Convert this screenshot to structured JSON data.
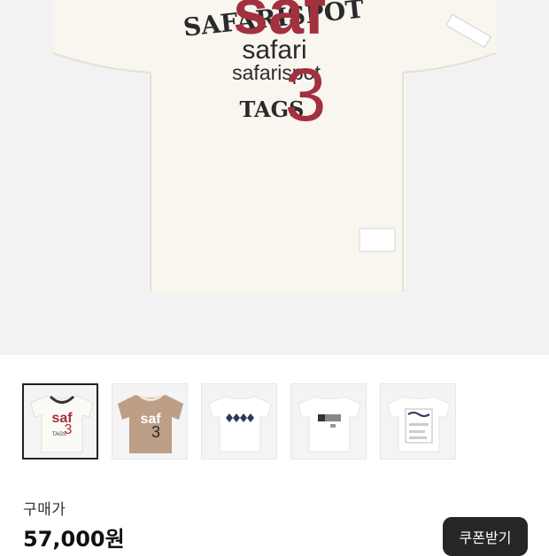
{
  "product": {
    "image": {
      "print_top": "SAFARISPOT",
      "print_big": "saf",
      "print_mid1": "safari",
      "print_mid2": "safarispot",
      "print_number": "3",
      "print_bottom": "TAGS",
      "garment_color": "#f8f6ef",
      "accent_color": "#a3303f",
      "text_color": "#2a2a2a"
    },
    "thumbnails": [
      {
        "name": "thumbnail-white-tee",
        "selected": true,
        "big": "saf",
        "number": "3",
        "small": "TAGS"
      },
      {
        "name": "thumbnail-beige-tee",
        "selected": false,
        "big": "saf",
        "number": "3",
        "small": ""
      },
      {
        "name": "thumbnail-pattern-tee",
        "selected": false
      },
      {
        "name": "thumbnail-stripe-tee",
        "selected": false
      },
      {
        "name": "thumbnail-graphic-tee",
        "selected": false
      }
    ]
  },
  "pricing": {
    "label": "구매가",
    "price": "57,000원",
    "coupon_button": "쿠폰받기"
  }
}
